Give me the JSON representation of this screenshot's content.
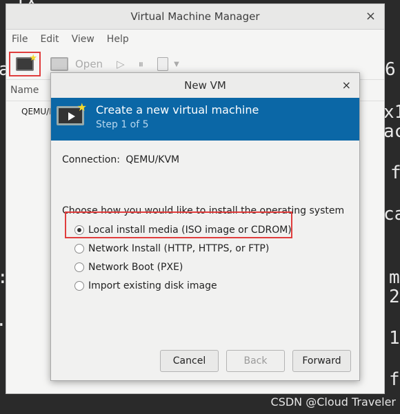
{
  "main_window": {
    "title": "Virtual Machine Manager",
    "close": "×",
    "menu": [
      "File",
      "Edit",
      "View",
      "Help"
    ],
    "toolbar": {
      "open_label": "Open"
    },
    "list_header": "Name",
    "list_rows": [
      "QEMU/K"
    ]
  },
  "dialog": {
    "title": "New VM",
    "close": "×",
    "banner": {
      "title": "Create a new virtual machine",
      "step": "Step 1 of 5"
    },
    "connection_label": "Connection:",
    "connection_value": "QEMU/KVM",
    "choose_label": "Choose how you would like to install the operating system",
    "options": [
      {
        "label": "Local install media (ISO image or CDROM)",
        "selected": true
      },
      {
        "label": "Network Install (HTTP, HTTPS, or FTP)",
        "selected": false
      },
      {
        "label": "Network Boot (PXE)",
        "selected": false
      },
      {
        "label": "Import existing disk image",
        "selected": false
      }
    ],
    "buttons": {
      "cancel": "Cancel",
      "back": "Back",
      "forward": "Forward"
    }
  },
  "watermark": "CSDN @Cloud Traveler",
  "terminal_fragments": [
    "TX",
    "a",
    "6",
    "x1",
    "ac",
    "f",
    "ca",
    ":",
    "m",
    "2",
    ".",
    "1",
    "f"
  ],
  "colors": {
    "banner": "#0b67a6",
    "highlight": "#e03c3c"
  }
}
